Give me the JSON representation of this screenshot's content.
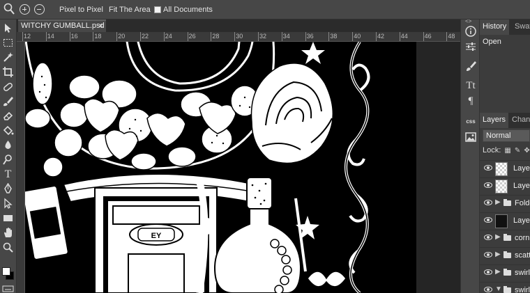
{
  "options_bar": {
    "pixel_to_pixel": "Pixel to Pixel",
    "fit_the_area": "Fit The Area",
    "all_documents": "All Documents",
    "all_documents_checked": false
  },
  "document": {
    "tab_name": "WITCHY GUMBALL.psd",
    "close_symbol": "×"
  },
  "ruler": {
    "ticks": [
      "12",
      "14",
      "16",
      "18",
      "20",
      "22",
      "24",
      "26",
      "28",
      "30",
      "32",
      "34",
      "36",
      "38",
      "40",
      "42",
      "44",
      "46",
      "48"
    ]
  },
  "canvas": {
    "label_text": "EY"
  },
  "panel": {
    "collapse_symbol": "<>",
    "history_tab": "History",
    "swatches_tab": "Swatc",
    "history_items": [
      "Open"
    ],
    "layers_tab": "Layers",
    "channels_tab": "Chann",
    "blend_mode": "Normal",
    "lock_label": "Lock:",
    "layers": [
      {
        "name": "Layer",
        "type": "layer",
        "thumb": "check"
      },
      {
        "name": "Layer",
        "type": "layer",
        "thumb": "check"
      },
      {
        "name": "Folde",
        "type": "folder"
      },
      {
        "name": "Layer",
        "type": "layer",
        "thumb": "art"
      },
      {
        "name": "corn",
        "type": "folder"
      },
      {
        "name": "scatt",
        "type": "folder"
      },
      {
        "name": "swirl",
        "type": "folder"
      },
      {
        "name": "swirl",
        "type": "folder",
        "expanded": true
      }
    ]
  },
  "icon_column": {
    "css_label": "css"
  },
  "colors": {
    "chrome": "#474747",
    "panel": "#3c3c3c",
    "artboard": "#000000",
    "ink": "#ffffff"
  }
}
